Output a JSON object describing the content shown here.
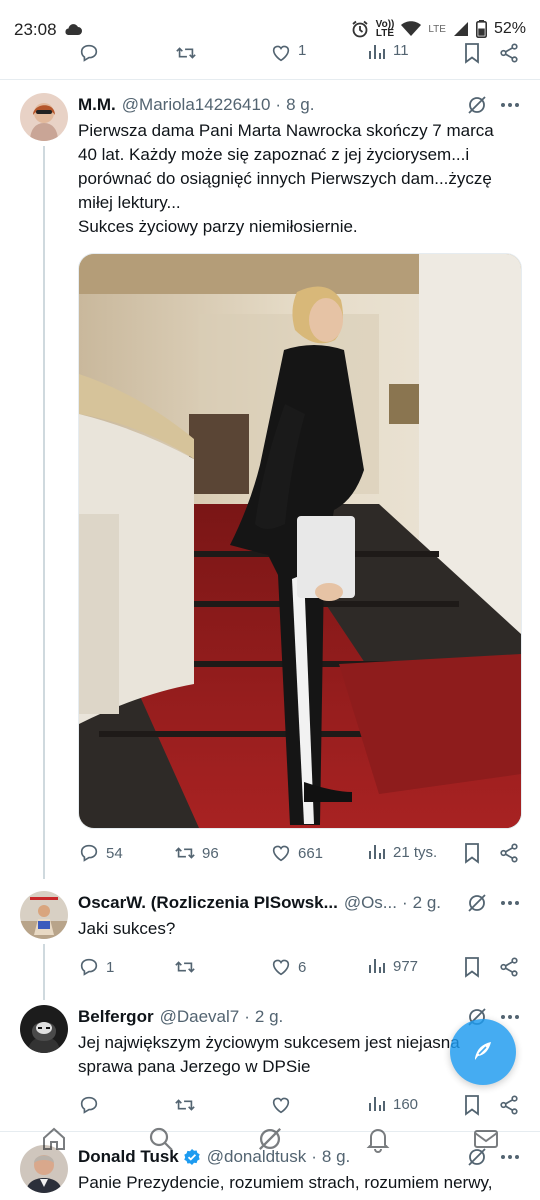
{
  "status_bar": {
    "time": "23:08",
    "battery": "52%",
    "network_label_top": "Vo))",
    "network_label_bottom": "LTE",
    "lte": "LTE"
  },
  "tweets": [
    {
      "display_name": "M.M.",
      "handle": "@Mariola14226410",
      "time": "8 g.",
      "text_lines": [
        "Pierwsza dama Pani Marta Nawrocka skończy 7 marca",
        "40 lat. Każdy może się zapoznać z jej życiorysem...i",
        "porównać do osiągnięć innych Pierwszych dam...życzę",
        "miłej lektury...",
        "Sukces życiowy parzy niemiłosiernie."
      ],
      "replies": "54",
      "retweets": "96",
      "likes": "661",
      "views": "21 tys."
    },
    {
      "display_name": "OscarW. (Rozliczenia PISowsk...",
      "handle": "@Os...",
      "time": "2 g.",
      "text": "Jaki sukces?",
      "replies": "1",
      "retweets": "",
      "likes": "6",
      "views": "977"
    },
    {
      "display_name": "Belfergor",
      "handle": "@Daeval7",
      "time": "2 g.",
      "text_lines": [
        "Jej największym życiowym sukcesem jest niejasna",
        "sprawa pana Jerzego w DPSie"
      ],
      "replies": "",
      "retweets": "",
      "likes": "",
      "views": "160"
    },
    {
      "display_name": "Donald Tusk",
      "handle": "@donaldtusk",
      "time": "8 g.",
      "text": "Panie Prezydencie, rozumiem strach, rozumiem nerwy,"
    }
  ],
  "previous_tweet_actions": {
    "likes": "1",
    "views": "11"
  },
  "colors": {
    "accent": "#1d9bf0",
    "text": "#0f1419",
    "secondary": "#536471",
    "verified": "#1d9bf0"
  },
  "icons": [
    "cloud-icon",
    "alarm-icon",
    "volte-icon",
    "wifi-icon",
    "signal-icon",
    "battery-icon",
    "grok-icon",
    "more-icon",
    "reply-icon",
    "retweet-icon",
    "like-icon",
    "views-icon",
    "bookmark-icon",
    "share-icon",
    "compose-icon",
    "home-icon",
    "search-icon",
    "notifications-icon",
    "messages-icon",
    "verified-icon"
  ]
}
